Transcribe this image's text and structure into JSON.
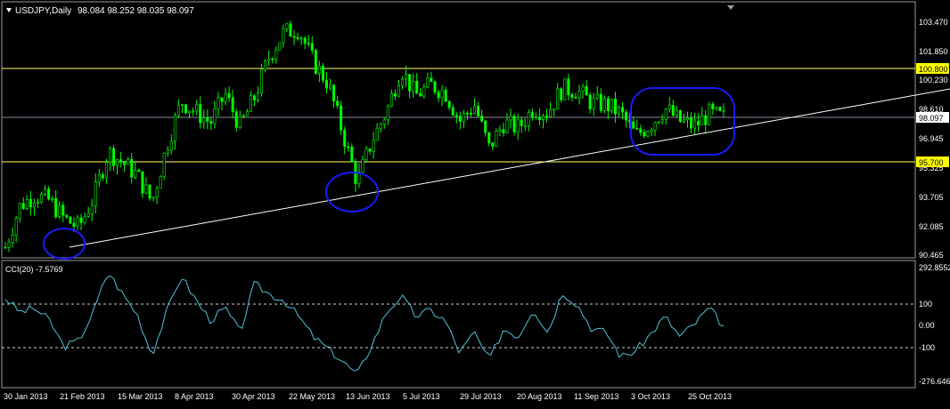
{
  "header": {
    "symbol_label": "USDJPY,Daily",
    "ohlc": "98.084 98.252 98.035 98.097"
  },
  "indicator": {
    "label": "CCI(20) -7.5769"
  },
  "price_axis": {
    "ticks": [
      "103.470",
      "101.850",
      "100.230",
      "98.610",
      "96.945",
      "95.325",
      "93.705",
      "92.085",
      "90.465"
    ],
    "current_price": "98.097",
    "level_upper": "100.800",
    "level_lower": "95.700"
  },
  "cci_axis": {
    "ticks": [
      "292.8552",
      "100",
      "0.00",
      "-100",
      "-276.646"
    ]
  },
  "date_axis": {
    "labels": [
      "30 Jan 2013",
      "21 Feb 2013",
      "15 Mar 2013",
      "8 Apr 2013",
      "30 Apr 2013",
      "22 May 2013",
      "13 Jun 2013",
      "5 Jul 2013",
      "29 Jul 2013",
      "20 Aug 2013",
      "11 Sep 2013",
      "3 Oct 2013",
      "25 Oct 2013"
    ]
  },
  "colors": {
    "background": "#000000",
    "candle": "#00ff00",
    "cci_line": "#4fc3d9",
    "horizontal_level": "#ffff66",
    "trendline": "#ffffff",
    "annotation_circle": "#1a1aff",
    "label_yellow": "#ffff00",
    "grid_text": "#ffffff"
  },
  "chart_data": {
    "type": "candlestick",
    "symbol": "USDJPY",
    "timeframe": "Daily",
    "price_range": [
      90.465,
      103.47
    ],
    "horizontal_levels": [
      100.8,
      95.7
    ],
    "current_price": 98.097,
    "trendline": {
      "start": {
        "date": "21 Feb 2013",
        "price": 91.0
      },
      "end": {
        "date": "25 Oct 2013",
        "price": 97.8
      }
    },
    "close_path": [
      {
        "date": "30 Jan 2013",
        "price": 90.9
      },
      {
        "date": "5 Feb 2013",
        "price": 93.2
      },
      {
        "date": "11 Feb 2013",
        "price": 93.8
      },
      {
        "date": "15 Feb 2013",
        "price": 93.5
      },
      {
        "date": "21 Feb 2013",
        "price": 92.5
      },
      {
        "date": "26 Feb 2013",
        "price": 92.0
      },
      {
        "date": "5 Mar 2013",
        "price": 93.6
      },
      {
        "date": "11 Mar 2013",
        "price": 96.2
      },
      {
        "date": "15 Mar 2013",
        "price": 95.6
      },
      {
        "date": "22 Mar 2013",
        "price": 94.9
      },
      {
        "date": "1 Apr 2013",
        "price": 93.4
      },
      {
        "date": "4 Apr 2013",
        "price": 96.5
      },
      {
        "date": "8 Apr 2013",
        "price": 99.0
      },
      {
        "date": "12 Apr 2013",
        "price": 98.4
      },
      {
        "date": "18 Apr 2013",
        "price": 97.8
      },
      {
        "date": "24 Apr 2013",
        "price": 99.4
      },
      {
        "date": "30 Apr 2013",
        "price": 97.6
      },
      {
        "date": "6 May 2013",
        "price": 99.2
      },
      {
        "date": "10 May 2013",
        "price": 101.5
      },
      {
        "date": "16 May 2013",
        "price": 102.8
      },
      {
        "date": "22 May 2013",
        "price": 103.0
      },
      {
        "date": "27 May 2013",
        "price": 101.2
      },
      {
        "date": "3 Jun 2013",
        "price": 100.0
      },
      {
        "date": "7 Jun 2013",
        "price": 97.3
      },
      {
        "date": "13 Jun 2013",
        "price": 94.5
      },
      {
        "date": "19 Jun 2013",
        "price": 96.8
      },
      {
        "date": "27 Jun 2013",
        "price": 98.4
      },
      {
        "date": "5 Jul 2013",
        "price": 100.8
      },
      {
        "date": "11 Jul 2013",
        "price": 99.3
      },
      {
        "date": "17 Jul 2013",
        "price": 99.9
      },
      {
        "date": "23 Jul 2013",
        "price": 99.5
      },
      {
        "date": "29 Jul 2013",
        "price": 97.9
      },
      {
        "date": "2 Aug 2013",
        "price": 98.8
      },
      {
        "date": "8 Aug 2013",
        "price": 96.4
      },
      {
        "date": "14 Aug 2013",
        "price": 97.8
      },
      {
        "date": "20 Aug 2013",
        "price": 97.5
      },
      {
        "date": "26 Aug 2013",
        "price": 98.6
      },
      {
        "date": "30 Aug 2013",
        "price": 98.4
      },
      {
        "date": "5 Sep 2013",
        "price": 99.7
      },
      {
        "date": "11 Sep 2013",
        "price": 99.6
      },
      {
        "date": "17 Sep 2013",
        "price": 98.9
      },
      {
        "date": "23 Sep 2013",
        "price": 98.8
      },
      {
        "date": "27 Sep 2013",
        "price": 98.3
      },
      {
        "date": "3 Oct 2013",
        "price": 97.1
      },
      {
        "date": "9 Oct 2013",
        "price": 97.7
      },
      {
        "date": "15 Oct 2013",
        "price": 98.6
      },
      {
        "date": "21 Oct 2013",
        "price": 97.9
      },
      {
        "date": "25 Oct 2013",
        "price": 97.6
      },
      {
        "date": "31 Oct 2013",
        "price": 98.3
      },
      {
        "date": "6 Nov 2013",
        "price": 98.1
      }
    ],
    "cci_range": [
      -276.646,
      292.8552
    ],
    "cci_levels": [
      100,
      0,
      -100
    ],
    "cci_last": -7.5769,
    "cci_path": [
      {
        "date": "30 Jan 2013",
        "value": 130
      },
      {
        "date": "5 Feb 2013",
        "value": 60
      },
      {
        "date": "11 Feb 2013",
        "value": 80
      },
      {
        "date": "15 Feb 2013",
        "value": 20
      },
      {
        "date": "21 Feb 2013",
        "value": -110
      },
      {
        "date": "26 Feb 2013",
        "value": -80
      },
      {
        "date": "5 Mar 2013",
        "value": 60
      },
      {
        "date": "11 Mar 2013",
        "value": 260
      },
      {
        "date": "15 Mar 2013",
        "value": 150
      },
      {
        "date": "22 Mar 2013",
        "value": 50
      },
      {
        "date": "1 Apr 2013",
        "value": -150
      },
      {
        "date": "4 Apr 2013",
        "value": 60
      },
      {
        "date": "8 Apr 2013",
        "value": 240
      },
      {
        "date": "12 Apr 2013",
        "value": 120
      },
      {
        "date": "18 Apr 2013",
        "value": 20
      },
      {
        "date": "24 Apr 2013",
        "value": 80
      },
      {
        "date": "30 Apr 2013",
        "value": -40
      },
      {
        "date": "6 May 2013",
        "value": 200
      },
      {
        "date": "10 May 2013",
        "value": 150
      },
      {
        "date": "16 May 2013",
        "value": 120
      },
      {
        "date": "22 May 2013",
        "value": 40
      },
      {
        "date": "27 May 2013",
        "value": -60
      },
      {
        "date": "3 Jun 2013",
        "value": -120
      },
      {
        "date": "7 Jun 2013",
        "value": -180
      },
      {
        "date": "13 Jun 2013",
        "value": -250
      },
      {
        "date": "19 Jun 2013",
        "value": -100
      },
      {
        "date": "27 Jun 2013",
        "value": 60
      },
      {
        "date": "5 Jul 2013",
        "value": 140
      },
      {
        "date": "11 Jul 2013",
        "value": 40
      },
      {
        "date": "17 Jul 2013",
        "value": 70
      },
      {
        "date": "23 Jul 2013",
        "value": 20
      },
      {
        "date": "29 Jul 2013",
        "value": -140
      },
      {
        "date": "2 Aug 2013",
        "value": -40
      },
      {
        "date": "8 Aug 2013",
        "value": -180
      },
      {
        "date": "14 Aug 2013",
        "value": -20
      },
      {
        "date": "20 Aug 2013",
        "value": -60
      },
      {
        "date": "26 Aug 2013",
        "value": 80
      },
      {
        "date": "30 Aug 2013",
        "value": -40
      },
      {
        "date": "5 Sep 2013",
        "value": 160
      },
      {
        "date": "11 Sep 2013",
        "value": 100
      },
      {
        "date": "17 Sep 2013",
        "value": -20
      },
      {
        "date": "23 Sep 2013",
        "value": -40
      },
      {
        "date": "27 Sep 2013",
        "value": -160
      },
      {
        "date": "3 Oct 2013",
        "value": -130
      },
      {
        "date": "9 Oct 2013",
        "value": -50
      },
      {
        "date": "15 Oct 2013",
        "value": 40
      },
      {
        "date": "21 Oct 2013",
        "value": -60
      },
      {
        "date": "25 Oct 2013",
        "value": 0
      },
      {
        "date": "31 Oct 2013",
        "value": 80
      },
      {
        "date": "6 Nov 2013",
        "value": -8
      }
    ]
  }
}
